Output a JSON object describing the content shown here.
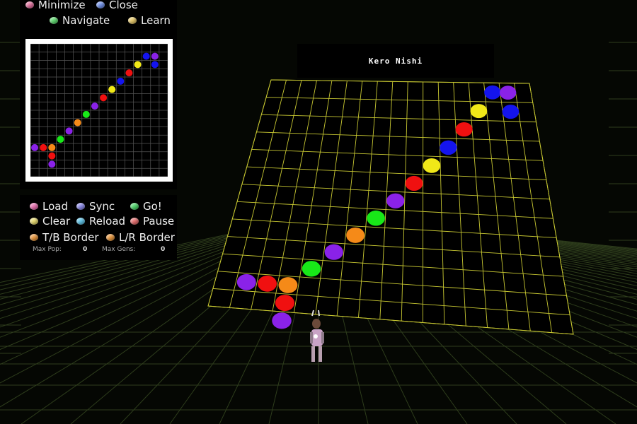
{
  "menu": {
    "minimize": {
      "label": "Minimize",
      "color": "#e0719e"
    },
    "close": {
      "label": "Close",
      "color": "#6f8fe6"
    },
    "navigate": {
      "label": "Navigate",
      "color": "#5fd66f"
    },
    "learn": {
      "label": "Learn",
      "color": "#e6c86a"
    }
  },
  "controls": {
    "load": {
      "label": "Load",
      "color": "#e66fae"
    },
    "sync": {
      "label": "Sync",
      "color": "#8a88e6"
    },
    "go": {
      "label": "Go!",
      "color": "#4ed36a"
    },
    "clear": {
      "label": "Clear",
      "color": "#e6d96f"
    },
    "reload": {
      "label": "Reload",
      "color": "#5fc2e6"
    },
    "pause": {
      "label": "Pause",
      "color": "#e66f6f"
    },
    "tb_border": {
      "label": "T/B Border",
      "color": "#e6963e"
    },
    "lr_border": {
      "label": "L/R Border",
      "color": "#e6963e"
    }
  },
  "stats": {
    "max_pop_label": "Max Pop:",
    "max_pop_value": "0",
    "max_gens_label": "Max Gens:",
    "max_gens_value": "0"
  },
  "board_title": "Kero Nishi",
  "colors": {
    "grid_line": "#c8c832",
    "floor_line": "#2a3a18",
    "cell_colors": {
      "violet": "#8a22e8",
      "red": "#f01010",
      "orange": "#f58a18",
      "yellow": "#f0e818",
      "green": "#18e818",
      "blue": "#1414ee"
    }
  },
  "cells": [
    {
      "c": 0,
      "r": 9,
      "color": "violet"
    },
    {
      "c": 1,
      "r": 9,
      "color": "red"
    },
    {
      "c": 2,
      "r": 9,
      "color": "orange"
    },
    {
      "c": 2,
      "r": 10,
      "color": "red"
    },
    {
      "c": 2,
      "r": 11,
      "color": "violet"
    },
    {
      "c": 3,
      "r": 8,
      "color": "green"
    },
    {
      "c": 4,
      "r": 7,
      "color": "violet"
    },
    {
      "c": 5,
      "r": 6,
      "color": "orange"
    },
    {
      "c": 6,
      "r": 5,
      "color": "green"
    },
    {
      "c": 7,
      "r": 4,
      "color": "violet"
    },
    {
      "c": 8,
      "r": 3,
      "color": "red"
    },
    {
      "c": 9,
      "r": 2,
      "color": "yellow"
    },
    {
      "c": 10,
      "r": 1,
      "color": "blue"
    },
    {
      "c": 11,
      "r": 0,
      "color": "red"
    },
    {
      "c": 12,
      "r": -1,
      "color": "yellow"
    },
    {
      "c": 13,
      "r": -2,
      "color": "blue"
    },
    {
      "c": 14,
      "r": -2,
      "color": "violet"
    },
    {
      "c": 14,
      "r": -1,
      "color": "blue"
    }
  ]
}
